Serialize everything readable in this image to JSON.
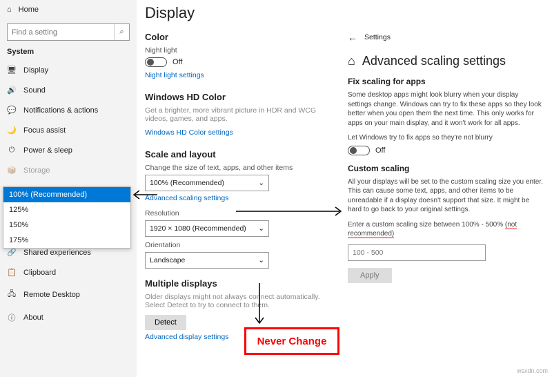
{
  "left": {
    "home": "Home",
    "search_placeholder": "Find a setting",
    "category": "System",
    "items": [
      {
        "icon": "🖥",
        "label": "Display"
      },
      {
        "icon": "🔊",
        "label": "Sound"
      },
      {
        "icon": "💬",
        "label": "Notifications & actions"
      },
      {
        "icon": "🌙",
        "label": "Focus assist"
      },
      {
        "icon": "⏻",
        "label": "Power & sleep"
      },
      {
        "icon": "📦",
        "label": "Storage"
      }
    ],
    "items2": [
      {
        "icon": "🔗",
        "label": "Shared experiences"
      },
      {
        "icon": "📋",
        "label": "Clipboard"
      },
      {
        "icon": "🖧",
        "label": "Remote Desktop"
      },
      {
        "icon": "ⓘ",
        "label": "About"
      }
    ]
  },
  "dropdown": {
    "options": [
      "100% (Recommended)",
      "125%",
      "150%",
      "175%"
    ]
  },
  "mid": {
    "title": "Display",
    "color_h": "Color",
    "nl_label": "Night light",
    "off": "Off",
    "nl_link": "Night light settings",
    "hd_h": "Windows HD Color",
    "hd_desc": "Get a brighter, more vibrant picture in HDR and WCG videos, games, and apps.",
    "hd_link": "Windows HD Color settings",
    "scale_h": "Scale and layout",
    "scale_lbl": "Change the size of text, apps, and other items",
    "scale_val": "100% (Recommended)",
    "adv_link": "Advanced scaling settings",
    "res_lbl": "Resolution",
    "res_val": "1920 × 1080 (Recommended)",
    "orient_lbl": "Orientation",
    "orient_val": "Landscape",
    "multi_h": "Multiple displays",
    "multi_desc": "Older displays might not always connect automatically. Select Detect to try to connect to them.",
    "detect": "Detect",
    "adv_disp": "Advanced display settings"
  },
  "right": {
    "back": "←",
    "settings": "Settings",
    "title": "Advanced scaling settings",
    "fix_h": "Fix scaling for apps",
    "fix_p": "Some desktop apps might look blurry when your display settings change. Windows can try to fix these apps so they look better when you open them the next time. This only works for apps on your main display, and it won't work for all apps.",
    "let_lbl": "Let Windows try to fix apps so they're not blurry",
    "off": "Off",
    "custom_h": "Custom scaling",
    "custom_p": "All your displays will be set to the custom scaling size you enter. This can cause some text, apps, and other items to be unreadable if a display doesn't support that size. It might be hard to go back to your original settings.",
    "custom_lbl_a": "Enter a custom scaling size between 100% - 500% ",
    "custom_lbl_b": "(not recommended)",
    "custom_ph": "100 - 500",
    "apply": "Apply"
  },
  "never": "Never Change",
  "watermark": "wsxdn.com"
}
